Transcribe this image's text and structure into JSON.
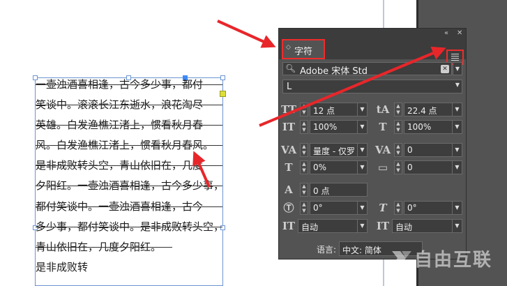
{
  "canvas": {
    "text_lines": [
      "一壶浊酒喜相逢，古今多少事，都付",
      "笑谈中。滚滚长江东逝水，浪花淘尽",
      "英雄。白发渔樵江渚上，惯看秋月春",
      "风。白发渔樵江渚上，惯看秋月春风。",
      "是非成败转头空，青山依旧在，几度",
      "夕阳红。一壶浊酒喜相逢，古今多少事，",
      "都付笑谈中。一壶浊酒喜相逢，古今",
      "多少事，都付笑谈中。是非成败转头空，",
      "青山依旧在，几度夕阳红。",
      "是非成败转"
    ]
  },
  "panel": {
    "collapse_glyph": "«",
    "close_glyph": "✕",
    "tab_arrows": "◇",
    "tab_label": "字符",
    "menu_icon": "panel-menu-icon",
    "font_family": "Adobe 宋体 Std",
    "font_style": "L",
    "font_size": "12 点",
    "leading": "22.4 点",
    "vertical_scale": "100%",
    "horizontal_scale": "100%",
    "kerning": "量度 - 仅罗",
    "tracking": "0",
    "baseline_shift_vertical": "0%",
    "tsume": "0",
    "aki": "0 点",
    "rotation": "0°",
    "skew": "0°",
    "grid_before": "自动",
    "grid_after": "自动",
    "language_label": "语言:",
    "language_value": "中文: 简体"
  },
  "watermark": {
    "text": "自由互联"
  },
  "colors": {
    "arrow": "#e8262a",
    "highlight": "#ee2c2c",
    "panel_bg": "#535353",
    "frame": "#6b94d0"
  }
}
